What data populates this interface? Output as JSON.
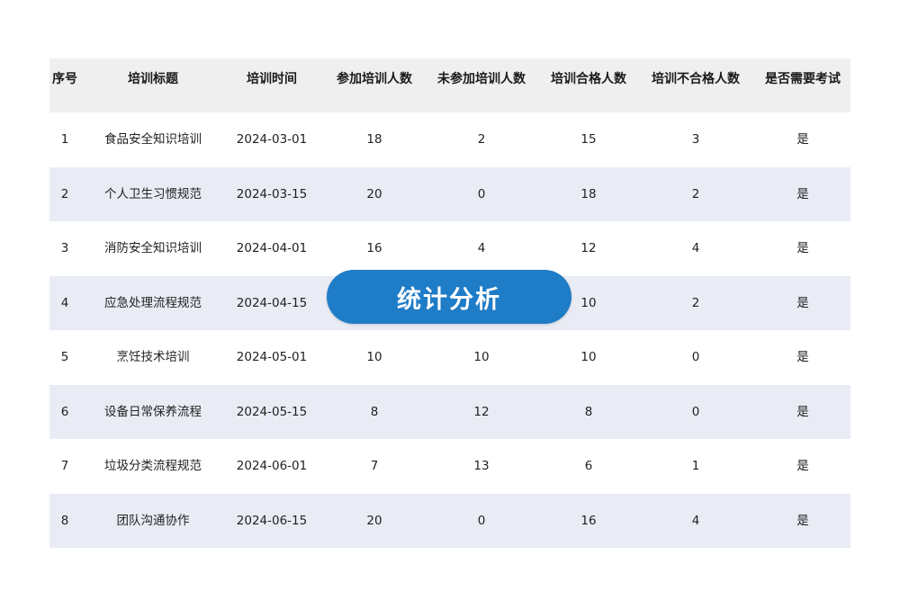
{
  "table": {
    "headers": [
      "序号",
      "培训标题",
      "培训时间",
      "参加培训人数",
      "未参加培训人数",
      "培训合格人数",
      "培训不合格人数",
      "是否需要考试"
    ],
    "rows": [
      [
        "1",
        "食品安全知识培训",
        "2024-03-01",
        "18",
        "2",
        "15",
        "3",
        "是"
      ],
      [
        "2",
        "个人卫生习惯规范",
        "2024-03-15",
        "20",
        "0",
        "18",
        "2",
        "是"
      ],
      [
        "3",
        "消防安全知识培训",
        "2024-04-01",
        "16",
        "4",
        "12",
        "4",
        "是"
      ],
      [
        "4",
        "应急处理流程规范",
        "2024-04-15",
        "",
        "",
        "10",
        "2",
        "是"
      ],
      [
        "5",
        "烹饪技术培训",
        "2024-05-01",
        "10",
        "10",
        "10",
        "0",
        "是"
      ],
      [
        "6",
        "设备日常保养流程",
        "2024-05-15",
        "8",
        "12",
        "8",
        "0",
        "是"
      ],
      [
        "7",
        "垃圾分类流程规范",
        "2024-06-01",
        "7",
        "13",
        "6",
        "1",
        "是"
      ],
      [
        "8",
        "团队沟通协作",
        "2024-06-15",
        "20",
        "0",
        "16",
        "4",
        "是"
      ]
    ]
  },
  "overlay_button": {
    "label": "统计分析"
  },
  "colors": {
    "header_bg": "#efefef",
    "alt_row_bg": "#e9ecf5",
    "accent": "#1f7cc7"
  }
}
